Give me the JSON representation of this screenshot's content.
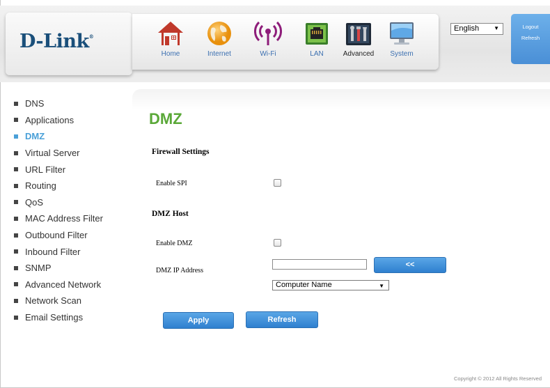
{
  "brand": {
    "logo": "D-Link",
    "trademark": "®"
  },
  "nav": [
    {
      "label": "Home",
      "icon": "home-icon",
      "active": false
    },
    {
      "label": "Internet",
      "icon": "globe-icon",
      "active": false
    },
    {
      "label": "Wi-Fi",
      "icon": "wifi-icon",
      "active": false
    },
    {
      "label": "LAN",
      "icon": "lan-port-icon",
      "active": false
    },
    {
      "label": "Advanced",
      "icon": "advanced-tools-icon",
      "active": true
    },
    {
      "label": "System",
      "icon": "monitor-icon",
      "active": false
    }
  ],
  "language": {
    "selected": "English"
  },
  "session": {
    "logout": "Logout",
    "refresh": "Refresh"
  },
  "sidebar": {
    "items": [
      {
        "label": "DNS"
      },
      {
        "label": "Applications"
      },
      {
        "label": "DMZ",
        "active": true
      },
      {
        "label": "Virtual Server"
      },
      {
        "label": "URL Filter"
      },
      {
        "label": "Routing"
      },
      {
        "label": "QoS"
      },
      {
        "label": "MAC Address Filter"
      },
      {
        "label": "Outbound Filter"
      },
      {
        "label": "Inbound Filter"
      },
      {
        "label": "SNMP"
      },
      {
        "label": "Advanced Network"
      },
      {
        "label": "Network Scan"
      },
      {
        "label": "Email Settings"
      }
    ]
  },
  "main": {
    "title": "DMZ",
    "firewall": {
      "heading": "Firewall Settings",
      "enable_spi_label": "Enable SPI",
      "enable_spi_checked": false
    },
    "dmz_host": {
      "heading": "DMZ Host",
      "enable_dmz_label": "Enable DMZ",
      "enable_dmz_checked": false,
      "ip_label": "DMZ IP Address",
      "ip_value": "",
      "copy_button": "<<",
      "computer_select": "Computer Name"
    },
    "apply_button": "Apply",
    "refresh_button": "Refresh"
  },
  "footer": {
    "copyright": "Copyright © 2012  All Rights Reserved"
  },
  "colors": {
    "accent_green": "#5aa838",
    "nav_blue": "#3b6fb0",
    "button_blue": "#3a8ad8",
    "active_link": "#4aa0d8",
    "logo": "#1a4f7a"
  }
}
